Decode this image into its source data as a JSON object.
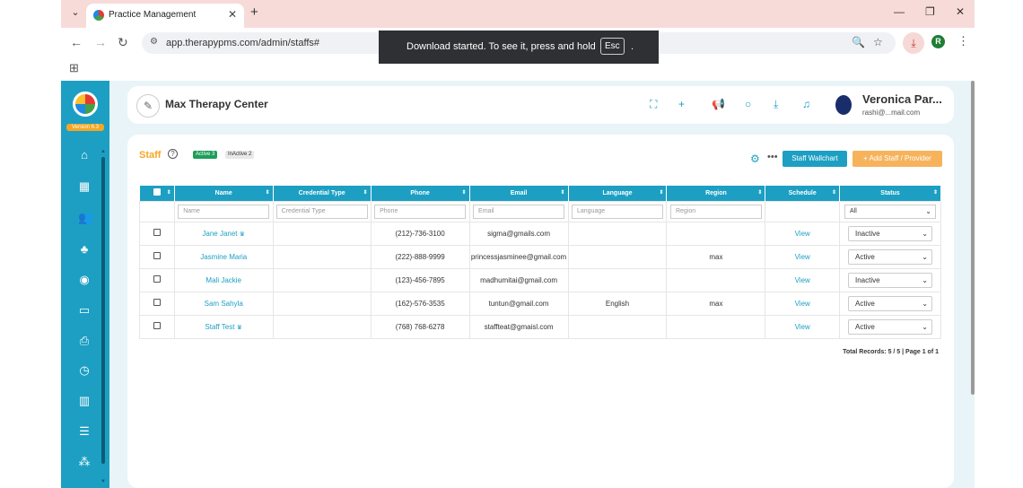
{
  "browser": {
    "tab_title": "Practice Management",
    "url": "app.therapypms.com/admin/staffs#",
    "profile_initial": "R",
    "toast": {
      "text": "Download started. To see it, press and hold",
      "key": "Esc",
      "suffix": "."
    }
  },
  "sidebar": {
    "version": "Version 6.3",
    "items": [
      "home-icon",
      "calendar-icon",
      "users-icon",
      "staff-icon",
      "settings-circle-icon",
      "billing-card-icon",
      "print-icon",
      "clock-icon",
      "reports-chart-icon",
      "menu-list-icon",
      "network-icon"
    ]
  },
  "header": {
    "center_name": "Max Therapy Center",
    "user_name": "Veronica Par...",
    "user_email": "rashi@...mail.com"
  },
  "staff": {
    "title": "Staff",
    "active_badge": "Active 3",
    "inactive_badge": "InActive 2",
    "wallchart_button": "Staff Wallchart",
    "add_button": "+ Add Staff / Provider",
    "columns": [
      "Name",
      "Credential Type",
      "Phone",
      "Email",
      "Language",
      "Region",
      "Schedule",
      "Status"
    ],
    "filters": {
      "name": "Name",
      "credential": "Credential Type",
      "phone": "Phone",
      "email": "Email",
      "language": "Language",
      "region": "Region",
      "status": "All"
    },
    "rows": [
      {
        "name": "Jane Janet",
        "crown": true,
        "credential": "",
        "phone": "(212)-736-3100",
        "email": "sigma@gmails.com",
        "language": "",
        "region": "",
        "schedule": "View",
        "status": "Inactive"
      },
      {
        "name": "Jasmine Maria",
        "crown": false,
        "credential": "",
        "phone": "(222)-888-9999",
        "email": "princessjasminee@gmail.com",
        "language": "",
        "region": "max",
        "schedule": "View",
        "status": "Active"
      },
      {
        "name": "Mali Jackie",
        "crown": false,
        "credential": "",
        "phone": "(123)-456-7895",
        "email": "madhumitai@gmail.com",
        "language": "",
        "region": "",
        "schedule": "View",
        "status": "Inactive"
      },
      {
        "name": "Sam Sahyla",
        "crown": false,
        "credential": "",
        "phone": "(162)-576-3535",
        "email": "tuntun@gmail.com",
        "language": "English",
        "region": "max",
        "schedule": "View",
        "status": "Active"
      },
      {
        "name": "Staff Test",
        "crown": true,
        "credential": "",
        "phone": "(768) 768-6278",
        "email": "staffteat@gmaisl.com",
        "language": "",
        "region": "",
        "schedule": "View",
        "status": "Active"
      }
    ],
    "total": "Total Records: 5 / 5 | Page 1 of 1"
  },
  "colors": {
    "primary": "#1d9fc3",
    "accent": "#f5a623",
    "success": "#1e9e5a"
  }
}
